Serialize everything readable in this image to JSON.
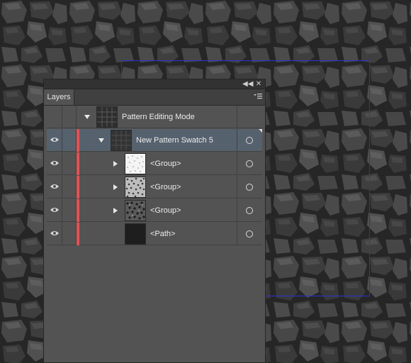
{
  "panel": {
    "title": "Layers",
    "collapse_icon": "collapse-arrows-icon",
    "close_icon": "close-icon",
    "menu_icon": "panel-menu-icon"
  },
  "layers": [
    {
      "label": "Pattern Editing Mode",
      "level": 0,
      "expanded": true,
      "visible": false,
      "selected": false,
      "color_bar": false,
      "thumb": "grid"
    },
    {
      "label": "New Pattern Swatch 5",
      "level": 1,
      "expanded": true,
      "visible": true,
      "selected": true,
      "color_bar": true,
      "thumb": "grid-dark"
    },
    {
      "label": "<Group>",
      "level": 2,
      "expanded": false,
      "visible": true,
      "selected": false,
      "color_bar": true,
      "thumb": "light-speckle"
    },
    {
      "label": "<Group>",
      "level": 2,
      "expanded": false,
      "visible": true,
      "selected": false,
      "color_bar": true,
      "thumb": "mid-speckle"
    },
    {
      "label": "<Group>",
      "level": 2,
      "expanded": false,
      "visible": true,
      "selected": false,
      "color_bar": true,
      "thumb": "dark-speckle"
    },
    {
      "label": "<Path>",
      "level": 2,
      "expanded": null,
      "visible": true,
      "selected": false,
      "color_bar": true,
      "thumb": "solid-dark"
    }
  ],
  "colors": {
    "layer_color": "#e05256",
    "selection": "#56616e",
    "tile_border": "#2a33c8"
  }
}
